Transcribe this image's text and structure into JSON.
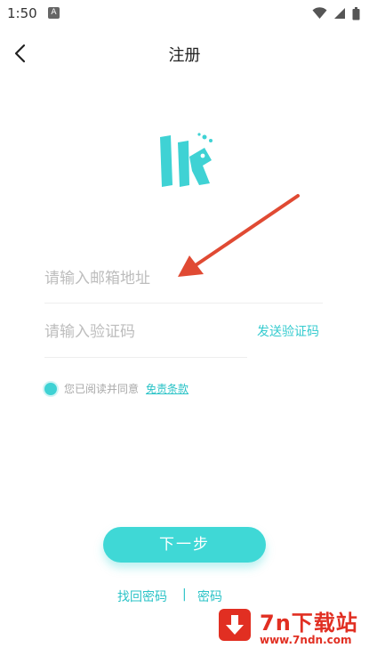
{
  "status_bar": {
    "time": "1:50",
    "notification_badge": "A"
  },
  "header": {
    "title": "注册",
    "back_icon": "chevron-left-icon"
  },
  "logo": {
    "colors": {
      "primary": "#3fd2d4"
    }
  },
  "form": {
    "email_placeholder": "请输入邮箱地址",
    "email_value": "",
    "code_placeholder": "请输入验证码",
    "code_value": "",
    "send_code_label": "发送验证码"
  },
  "agreement": {
    "checked": true,
    "text": "您已阅读并同意",
    "link_label": "免责条款"
  },
  "next_button": {
    "label": "下一步"
  },
  "bottom_links": {
    "forgot_label": "找回密码",
    "divider": "|",
    "login_label": "密码"
  },
  "watermark": {
    "brand": "7n下载站",
    "url": "www.7ndn.com"
  },
  "colors": {
    "accent": "#3fd8d6",
    "link": "#2bc3c7",
    "placeholder": "#bdbdbd",
    "watermark_red": "#e12f22"
  }
}
